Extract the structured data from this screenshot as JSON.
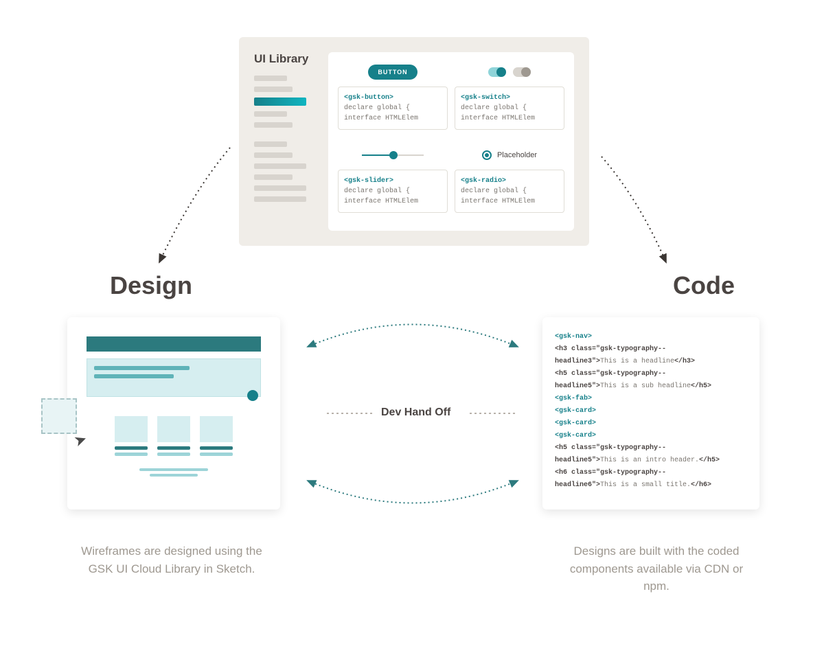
{
  "uiLibrary": {
    "title": "UI Library",
    "components": [
      {
        "preview": "button",
        "label": "BUTTON",
        "tag": "<gsk-button>",
        "line1": "declare global {",
        "line2": "  interface HTMLElem"
      },
      {
        "preview": "switch",
        "tag": "<gsk-switch>",
        "line1": "declare global {",
        "line2": "  interface HTMLElem"
      },
      {
        "preview": "slider",
        "tag": "<gsk-slider>",
        "line1": "declare global {",
        "line2": "  interface HTMLElem"
      },
      {
        "preview": "radio",
        "label": "Placeholder",
        "tag": "<gsk-radio>",
        "line1": "declare global {",
        "line2": "  interface HTMLElem"
      }
    ]
  },
  "headings": {
    "design": "Design",
    "code": "Code",
    "devHandoff": "Dev Hand Off"
  },
  "captions": {
    "design": "Wireframes are designed using the GSK UI Cloud Library in Sketch.",
    "code": "Designs are built with the coded components available via CDN or npm."
  },
  "codePanel": {
    "lines": [
      {
        "parts": [
          {
            "cls": "ct-teal",
            "t": "<gsk-nav>"
          }
        ]
      },
      {
        "parts": [
          {
            "cls": "ct-bold",
            "t": "<h3 class=\"gsk-typography--"
          }
        ]
      },
      {
        "parts": [
          {
            "cls": "ct-bold",
            "t": "headline3\">"
          },
          {
            "cls": "ct-txt",
            "t": "This is a headline"
          },
          {
            "cls": "ct-bold",
            "t": "</h3>"
          }
        ]
      },
      {
        "parts": [
          {
            "cls": "ct-bold",
            "t": "<h5 class=\"gsk-typography--"
          }
        ]
      },
      {
        "parts": [
          {
            "cls": "ct-bold",
            "t": "headline5\">"
          },
          {
            "cls": "ct-txt",
            "t": "This is a sub headline"
          },
          {
            "cls": "ct-bold",
            "t": "</h5>"
          }
        ]
      },
      {
        "parts": [
          {
            "cls": "ct-teal",
            "t": "<gsk-fab>"
          }
        ]
      },
      {
        "parts": [
          {
            "cls": "ct-teal",
            "t": "<gsk-card>"
          }
        ]
      },
      {
        "parts": [
          {
            "cls": "ct-teal",
            "t": "<gsk-card>"
          }
        ]
      },
      {
        "parts": [
          {
            "cls": "ct-teal",
            "t": "<gsk-card>"
          }
        ]
      },
      {
        "parts": [
          {
            "cls": "ct-bold",
            "t": "<h5 class=\"gsk-typography--"
          }
        ]
      },
      {
        "parts": [
          {
            "cls": "ct-bold",
            "t": "headline5\">"
          },
          {
            "cls": "ct-txt",
            "t": "This is an intro header."
          },
          {
            "cls": "ct-bold",
            "t": "</h5>"
          }
        ]
      },
      {
        "parts": [
          {
            "cls": "ct-bold",
            "t": "<h6 class=\"gsk-typography--"
          }
        ]
      },
      {
        "parts": [
          {
            "cls": "ct-bold",
            "t": "headline6\">"
          },
          {
            "cls": "ct-txt",
            "t": "This is a small title."
          },
          {
            "cls": "ct-bold",
            "t": "</h6>"
          }
        ]
      }
    ]
  }
}
